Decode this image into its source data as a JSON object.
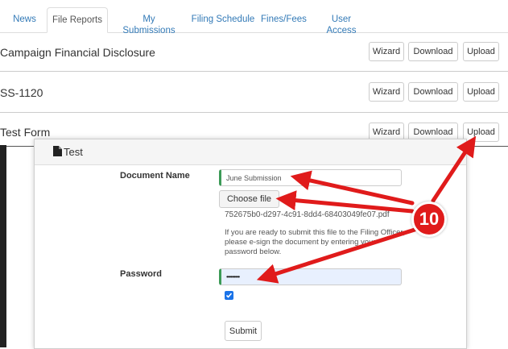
{
  "tabs": [
    {
      "label": "News",
      "active": false
    },
    {
      "label": "File Reports",
      "active": true
    },
    {
      "label": "My Submissions",
      "active": false
    },
    {
      "label": "Filing Schedule",
      "active": false
    },
    {
      "label": "Fines/Fees",
      "active": false
    },
    {
      "label": "User Access",
      "active": false
    }
  ],
  "reports": [
    {
      "title": "Campaign Financial Disclosure",
      "wizard": "Wizard",
      "download": "Download",
      "upload": "Upload"
    },
    {
      "title": "SS-1120",
      "wizard": "Wizard",
      "download": "Download",
      "upload": "Upload"
    },
    {
      "title": "Test Form",
      "wizard": "Wizard",
      "download": "Download",
      "upload": "Upload"
    }
  ],
  "dialog": {
    "title": "Test",
    "icon": "document-icon",
    "document_name_label": "Document Name",
    "document_name_value": "June Submission",
    "choose_file_label": "Choose file",
    "file_name": "752675b0-d297-4c91-8dd4-68403049fe07.pdf",
    "help_text_lines": [
      "If you are ready to submit this file to the Filing Officer,",
      "please e-sign the document by entering your",
      "password below."
    ],
    "password_label": "Password",
    "password_value": "•••••••••",
    "esign_checked": true,
    "submit_label": "Submit"
  },
  "annotation": {
    "step": "10",
    "color": "#e01b1b"
  },
  "colors": {
    "link": "#337ab7",
    "valid_border": "#3c9a57",
    "password_bg": "#e8f0fe"
  }
}
